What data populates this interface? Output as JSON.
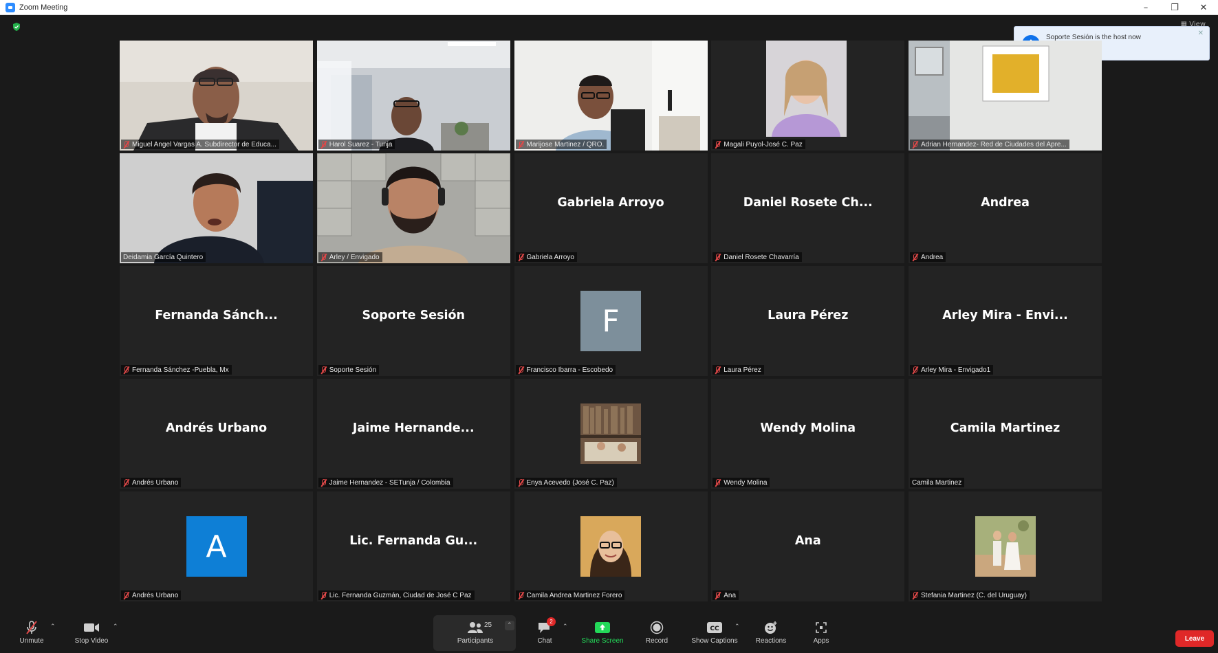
{
  "window": {
    "title": "Zoom Meeting"
  },
  "notification": {
    "message": "Soporte Sesión is the host now"
  },
  "view_label": "View",
  "tiles": [
    {
      "kind": "video",
      "label": "Miguel Angel Vargas A. Subdirector de Educa...",
      "muted": true,
      "scene": "office-man-glasses"
    },
    {
      "kind": "video",
      "label": "Harol Suarez - Tunja",
      "muted": true,
      "scene": "office-room"
    },
    {
      "kind": "video",
      "label": "Marijose Martinez / QRO.",
      "muted": true,
      "scene": "office-man"
    },
    {
      "kind": "video",
      "label": "Magali Puyol-José C. Paz",
      "muted": true,
      "scene": "woman-purple"
    },
    {
      "kind": "video",
      "label": "Adrian Hernandez- Red de Ciudades del Apre...",
      "muted": true,
      "scene": "wall-painting"
    },
    {
      "kind": "video",
      "label": "Deidamia García Quintero",
      "muted": false,
      "active": true,
      "scene": "woman-speaking"
    },
    {
      "kind": "video",
      "label": "Arley / Envigado",
      "muted": true,
      "scene": "man-headset"
    },
    {
      "kind": "name",
      "display": "Gabriela Arroyo",
      "label": "Gabriela Arroyo",
      "muted": true
    },
    {
      "kind": "name",
      "display": "Daniel Rosete Ch...",
      "label": "Daniel Rosete Chavarría",
      "muted": true
    },
    {
      "kind": "name",
      "display": "Andrea",
      "label": "Andrea",
      "muted": true
    },
    {
      "kind": "name",
      "display": "Fernanda Sánch...",
      "label": "Fernanda Sánchez -Puebla, Mx",
      "muted": true
    },
    {
      "kind": "name",
      "display": "Soporte Sesión",
      "label": "Soporte Sesión",
      "muted": true
    },
    {
      "kind": "avatar",
      "letter": "F",
      "color": "#7d8f9b",
      "label": "Francisco Ibarra - Escobedo",
      "muted": true
    },
    {
      "kind": "name",
      "display": "Laura Pérez",
      "label": "Laura Pérez",
      "muted": true
    },
    {
      "kind": "name",
      "display": "Arley Mira - Envi...",
      "label": "Arley Mira - Envigado1",
      "muted": true
    },
    {
      "kind": "name",
      "display": "Andrés Urbano",
      "label": "Andrés Urbano",
      "muted": true
    },
    {
      "kind": "name",
      "display": "Jaime Hernande...",
      "label": "Jaime Hernandez - SETunja / Colombia",
      "muted": true
    },
    {
      "kind": "photo",
      "photo": "library",
      "label": "Enya Acevedo (José C. Paz)",
      "muted": true
    },
    {
      "kind": "name",
      "display": "Wendy Molina",
      "label": "Wendy Molina",
      "muted": true
    },
    {
      "kind": "name",
      "display": "Camila Martinez",
      "label": "Camila Martinez",
      "muted": false
    },
    {
      "kind": "avatar",
      "letter": "A",
      "color": "#0e7fd6",
      "label": "Andrés Urbano",
      "muted": true
    },
    {
      "kind": "name",
      "display": "Lic. Fernanda Gu...",
      "label": "Lic. Fernanda Guzmán, Ciudad de José C Paz",
      "muted": true
    },
    {
      "kind": "photo",
      "photo": "woman-glasses",
      "label": "Camila Andrea Martinez Forero",
      "muted": true
    },
    {
      "kind": "name",
      "display": "Ana",
      "label": "Ana",
      "muted": true
    },
    {
      "kind": "photo",
      "photo": "couple",
      "label": "Stefania Martinez (C. del Uruguay)",
      "muted": true
    }
  ],
  "toolbar": {
    "unmute": "Unmute",
    "stop_video": "Stop Video",
    "participants": "Participants",
    "participant_count": "25",
    "chat": "Chat",
    "chat_badge": "2",
    "share_screen": "Share Screen",
    "record": "Record",
    "show_captions": "Show Captions",
    "reactions": "Reactions",
    "apps": "Apps",
    "leave": "Leave"
  },
  "colors": {
    "share_green": "#23d959",
    "leave_red": "#e02828",
    "active_speaker": "#cfe07e",
    "toast_info": "#0e71eb"
  }
}
